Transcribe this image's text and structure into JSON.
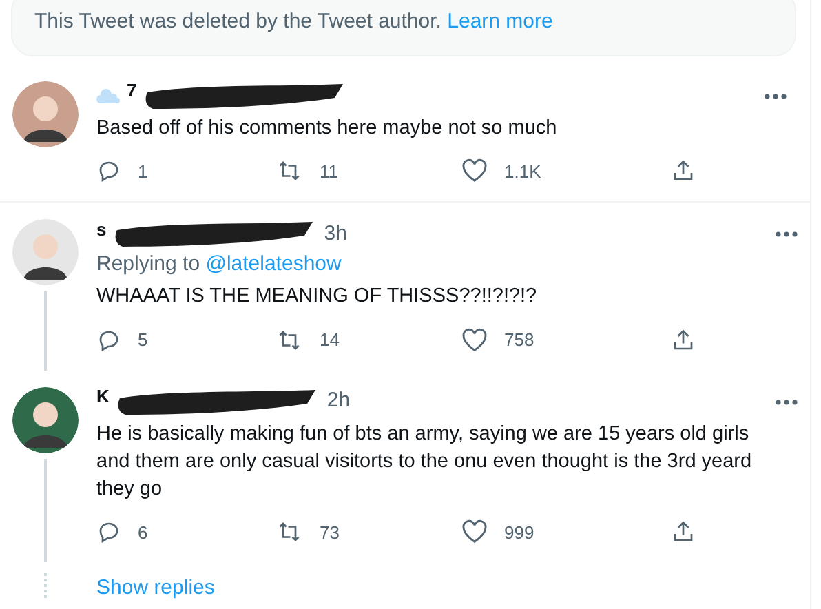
{
  "notice": {
    "text": "This Tweet was deleted by the Tweet author.",
    "link": "Learn more"
  },
  "tweets": [
    {
      "author": "7",
      "body": "Based off of his comments here maybe not so much",
      "replies": "1",
      "retweets": "11",
      "likes": "1.1K",
      "thread_below": false,
      "badge_emoji": true
    },
    {
      "author": "s",
      "time": "3h",
      "replying_to": "@latelateshow",
      "body": "WHAAAT IS THE MEANING OF THISSS??!!?!?!?",
      "replies": "5",
      "retweets": "14",
      "likes": "758",
      "thread_below": true
    },
    {
      "author": "K",
      "time": "2h",
      "body": "He is basically making fun of bts an army, saying we are 15 years old girls and them are only casual visitorts to the onu even thought is the 3rd yeard they go",
      "replies": "6",
      "retweets": "73",
      "likes": "999",
      "thread_below": true
    }
  ],
  "replying_label": "Replying to",
  "show_replies": "Show replies"
}
